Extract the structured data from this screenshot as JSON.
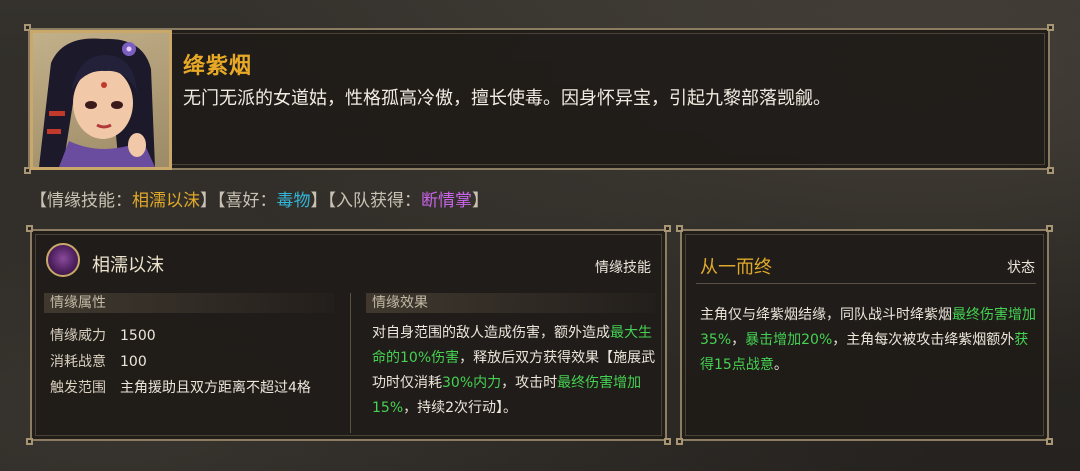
{
  "character": {
    "name": "绛紫烟",
    "description": "无门无派的女道姑，性格孤高冷傲，擅长使毒。因身怀异宝，引起九黎部落觊觎。"
  },
  "tags": {
    "open1": "【情缘技能：",
    "skill": "相濡以沫",
    "close1": "】【喜好：",
    "hobby": "毒物",
    "close2": "】【入队获得：",
    "gain": "断情掌",
    "close3": "】"
  },
  "skill_panel": {
    "title": "相濡以沫",
    "tag": "情缘技能",
    "attr_header": "情缘属性",
    "effect_header": "情缘效果",
    "attributes": [
      {
        "key": "情缘威力",
        "value": "1500"
      },
      {
        "key": "消耗战意",
        "value": "100"
      },
      {
        "key": "触发范围",
        "value": "主角援助且双方距离不超过4格"
      }
    ],
    "effect": {
      "p1": "对自身范围的敌人造成伤害，额外造成",
      "g1": "最大生命的10%伤害",
      "p2": "，释放后双方获得效果【施展武功时仅消耗",
      "g2": "30%内力",
      "p3": "，攻击时",
      "g3": "最终伤害增加15%",
      "p4": "，持续2次行动】。"
    }
  },
  "status_panel": {
    "title": "从一而终",
    "tag": "状态",
    "text": {
      "p1": "主角仅与绛紫烟结缘，同队战斗时绛紫烟",
      "g1": "最终伤害增加35%",
      "p2": "，",
      "g2": "暴击增加20%",
      "p3": "，主角每次被攻击绛紫烟额外",
      "g3": "获得15点战意",
      "p4": "。"
    }
  },
  "colors": {
    "name_gold": "#e8a927",
    "skill_gold": "#e0a92a",
    "hobby_cyan": "#33b4d6",
    "gain_violet": "#c864e8",
    "highlight_green": "#45d152"
  }
}
